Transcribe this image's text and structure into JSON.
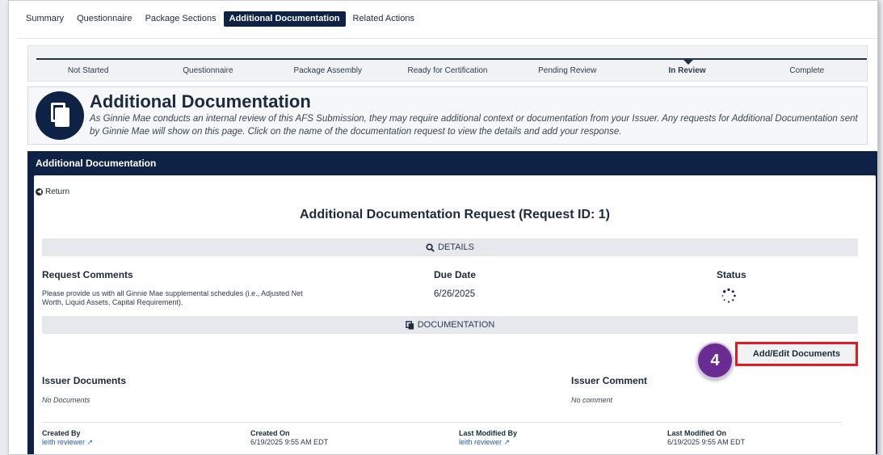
{
  "tabs": [
    "Summary",
    "Questionnaire",
    "Package Sections",
    "Additional Documentation",
    "Related Actions"
  ],
  "progress": {
    "steps": [
      "Not Started",
      "Questionnaire",
      "Package Assembly",
      "Ready for Certification",
      "Pending Review",
      "In Review",
      "Complete"
    ],
    "current": "In Review"
  },
  "header": {
    "title": "Additional Documentation",
    "description": "As Ginnie Mae conducts an internal review of this AFS Submission, they may require additional context or documentation from your Issuer. Any requests for Additional Documentation sent by Ginnie Mae will show on this page. Click on the name of the documentation request to view the details and add your response."
  },
  "panel": {
    "title": "Additional Documentation",
    "return_label": "Return",
    "request_title": "Additional Documentation Request (Request ID: 1)",
    "details_label": "DETAILS",
    "request_comments_label": "Request Comments",
    "request_comments": "Please provide us with all Ginnie Mae supplemental schedules (i.e., Adjusted Net Worth, Liquid Assets, Capital Requirement).",
    "due_date_label": "Due Date",
    "due_date": "6/26/2025",
    "status_label": "Status",
    "documentation_label": "DOCUMENTATION",
    "step_number": "4",
    "add_edit_label": "Add/Edit Documents",
    "issuer_documents_label": "Issuer Documents",
    "issuer_documents_empty": "No Documents",
    "issuer_comment_label": "Issuer Comment",
    "issuer_comment_empty": "No comment",
    "created_by_label": "Created By",
    "created_by": "leith reviewer",
    "created_on_label": "Created On",
    "created_on": "6/19/2025 9:55 AM EDT",
    "last_modified_by_label": "Last Modified By",
    "last_modified_by": "leith reviewer",
    "last_modified_on_label": "Last Modified On",
    "last_modified_on": "6/19/2025 9:55 AM EDT"
  },
  "colors": {
    "navy": "#0e2246",
    "accent_purple": "#6b2c91",
    "highlight_red": "#e01b24",
    "link_blue": "#1f5fae"
  }
}
